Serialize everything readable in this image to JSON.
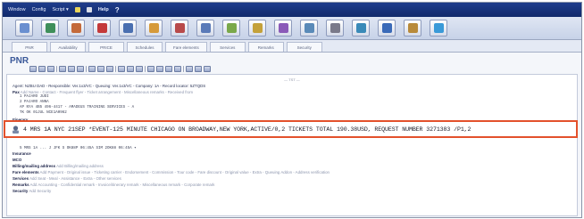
{
  "menu": {
    "window": "Window",
    "config": "Config",
    "script": "Script ▾",
    "help": "Help"
  },
  "toolbar_icons": [
    {
      "name": "calendar-icon",
      "color": "#6a8fd0"
    },
    {
      "name": "globe-icon",
      "color": "#3f8f5a"
    },
    {
      "name": "hotel-icon",
      "color": "#c46a3a"
    },
    {
      "name": "car-icon",
      "color": "#c43a3a"
    },
    {
      "name": "ship-icon",
      "color": "#4a6fb0"
    },
    {
      "name": "person-icon",
      "color": "#d69a3a"
    },
    {
      "name": "profile-icon",
      "color": "#b84a4a"
    },
    {
      "name": "ticket-icon",
      "color": "#5a7ab8"
    },
    {
      "name": "map-icon",
      "color": "#7aa84a"
    },
    {
      "name": "queue-icon",
      "color": "#c4a13a"
    },
    {
      "name": "document-icon",
      "color": "#8a5ab8"
    },
    {
      "name": "report-icon",
      "color": "#5a8ab8"
    },
    {
      "name": "settings-icon",
      "color": "#7a7a8a"
    },
    {
      "name": "cards-icon",
      "color": "#3a8ab8"
    },
    {
      "name": "info-icon",
      "color": "#3a6ab8"
    },
    {
      "name": "notes-icon",
      "color": "#b88a3a"
    },
    {
      "name": "help-icon",
      "color": "#3a9ad8"
    }
  ],
  "tabs": [
    "PNR",
    "Availability",
    "PRICE",
    "Schedules",
    "Fare elements",
    "Services",
    "Remarks",
    "Security"
  ],
  "pnr_title": "PNR",
  "header_sep": "— TST —",
  "agent_line": "Agent: NZBU DAD - Responsible: Ver.1x3/VC - Queuing: Ver.1x3/VC - Company: 1A - Record locator: 5ZTQDS",
  "pax": {
    "label": "Pax",
    "adds": "Add Name - Contact - Frequent flyer - Ticket arrangement - Miscellaneous remarks - Received from",
    "lines": [
      "1 PAJARO JUDI",
      "2 PAJARO ANNA",
      "AP NYA 4B5 496-4417 - AMADEUS TRAINING SERVICES - A",
      "TK OK 01JUL NCE1A0962"
    ]
  },
  "itinerary_label": "Itinerary",
  "highlight_text": "4  MRS  1A   NYC 21SEP *EVENT-125 MINUTE CHICAGO ON BROADWAY,NEW YORK,ACTIVE/0,2 TICKETS TOTAL 190.38USD, REQUEST NUMBER 3271383  /P1,2",
  "after_row": "5  MRS  1A   ...  J    JFK  S  OK88P  06:45A  SIM 2OK88 06:45A  ▾",
  "sections": [
    {
      "label": "Insurance",
      "adds": ""
    },
    {
      "label": "MCO",
      "adds": ""
    },
    {
      "label": "Billing/mailing address",
      "adds": "Add Billing/mailing address"
    },
    {
      "label": "Fare elements",
      "adds": "Add Payment - Original issue - Ticketing carrier - Endorsement - Commission - Tour code - Fare discount - Original value - Extra - Queuing Addon - Address verification"
    },
    {
      "label": "Services",
      "adds": "Add Seat - Meal - Assistance - Extra - Other services"
    },
    {
      "label": "Remarks",
      "adds": "Add Accounting - Confidential remark - Invoice/itinerary remark - Miscellaneous remark - Corporate remark"
    },
    {
      "label": "Security",
      "adds": "Add Security"
    }
  ]
}
